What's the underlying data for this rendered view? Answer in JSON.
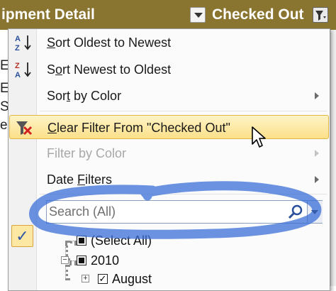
{
  "header": {
    "col_equipment": "ipment Detail",
    "col_checked_out": "Checked Out"
  },
  "sheet": {
    "row_fragments": [
      "E",
      "E",
      "S",
      "e"
    ]
  },
  "menu": {
    "sort_oldest": {
      "pre": "",
      "key": "S",
      "post": "ort Oldest to Newest"
    },
    "sort_newest": {
      "pre": "S",
      "key": "o",
      "post": "rt Newest to Oldest"
    },
    "sort_color": {
      "pre": "Sor",
      "key": "t",
      "post": " by Color"
    },
    "clear_filter": {
      "pre": "",
      "key": "C",
      "post": "lear Filter From \"Checked Out\""
    },
    "filter_color": {
      "pre": "Filter by Color",
      "key": "",
      "post": ""
    },
    "date_filters": {
      "pre": "Date ",
      "key": "F",
      "post": "ilters"
    }
  },
  "search": {
    "placeholder": "Search (All)"
  },
  "tree": {
    "select_all": "(Select All)",
    "year": "2010",
    "month": "August"
  },
  "colors": {
    "header_bg": "#8a7530",
    "highlight": "#fbe08a",
    "annotation": "#3a6fd8"
  }
}
